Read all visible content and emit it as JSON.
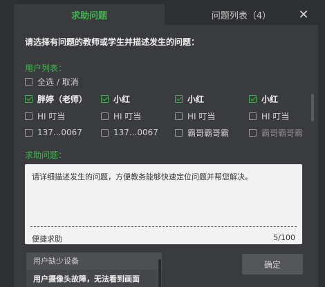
{
  "tabs": {
    "active": "求助问题",
    "other": "问题列表（4）"
  },
  "close_symbol": "✕",
  "instruction": "请选择有问题的教师或学生并描述发生的问题：",
  "user_list_label": "用户列表：",
  "select_all": "全选 / 取消",
  "rows": [
    [
      {
        "label": "胖婷（老师）",
        "checked": true,
        "style": "bold"
      },
      {
        "label": "小红",
        "checked": true,
        "style": "bold"
      },
      {
        "label": "小红",
        "checked": true,
        "style": "bold"
      },
      {
        "label": "小红",
        "checked": true,
        "style": "bold"
      }
    ],
    [
      {
        "label": "HI 叮当",
        "checked": false,
        "style": ""
      },
      {
        "label": "HI 叮当",
        "checked": false,
        "style": ""
      },
      {
        "label": "HI 叮当",
        "checked": false,
        "style": ""
      },
      {
        "label": "HI 叮当",
        "checked": false,
        "style": ""
      }
    ],
    [
      {
        "label": "137...0067",
        "checked": false,
        "style": ""
      },
      {
        "label": "137...0067",
        "checked": false,
        "style": ""
      },
      {
        "label": "霸哥霸哥霸",
        "checked": false,
        "style": ""
      },
      {
        "label": "霸哥霸哥霸",
        "checked": false,
        "style": "dim"
      }
    ]
  ],
  "help_label": "求助问题：",
  "textarea": {
    "text": "请详细描述发生的问题，方便教务能够快速定位问题并帮您解决。",
    "quick_help": "便捷求助",
    "count": "5/100"
  },
  "dropdown": {
    "item1": "用户缺少设备",
    "item2": "用户摄像头故障，无法看到画面"
  },
  "confirm": "确定"
}
